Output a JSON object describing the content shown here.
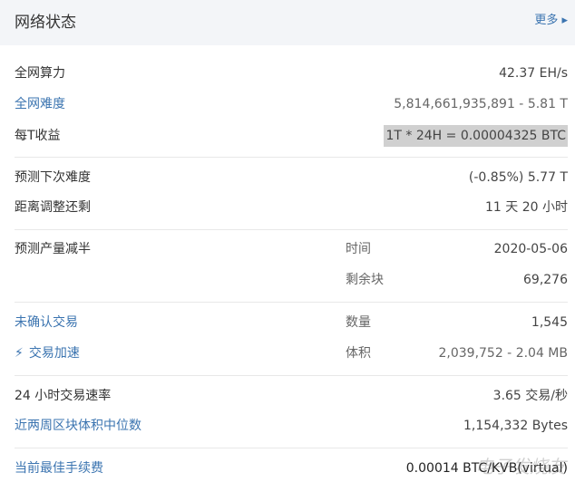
{
  "header": {
    "title": "网络状态",
    "more": "更多 ▸"
  },
  "rows": [
    {
      "label": "全网算力",
      "value": "42.37 EH/s"
    },
    {
      "label": "全网难度",
      "value": "5,814,661,935,891 - 5.81 T"
    },
    {
      "label": "每T收益",
      "value": "1T * 24H = 0.00004325 BTC"
    },
    {
      "label": "预测下次难度",
      "value": "(-0.85%) 5.77 T"
    },
    {
      "label": "距离调整还剩",
      "value": "11 天 20 小时"
    },
    {
      "label": "预测产量减半",
      "sub": "时间",
      "value": "2020-05-06"
    },
    {
      "label": "",
      "sub": "剩余块",
      "value": "69,276"
    },
    {
      "label": "未确认交易",
      "sub": "数量",
      "value": "1,545"
    },
    {
      "label": "交易加速",
      "sub": "体积",
      "value": "2,039,752 - 2.04 MB"
    },
    {
      "label": "24 小时交易速率",
      "value": "3.65 交易/秒"
    },
    {
      "label": "近两周区块体积中位数",
      "value": "1,154,332 Bytes"
    },
    {
      "label": "当前最佳手续费",
      "value": "0.00014 BTC/KVB(virtual)"
    }
  ],
  "watermark": "电子发烧友"
}
